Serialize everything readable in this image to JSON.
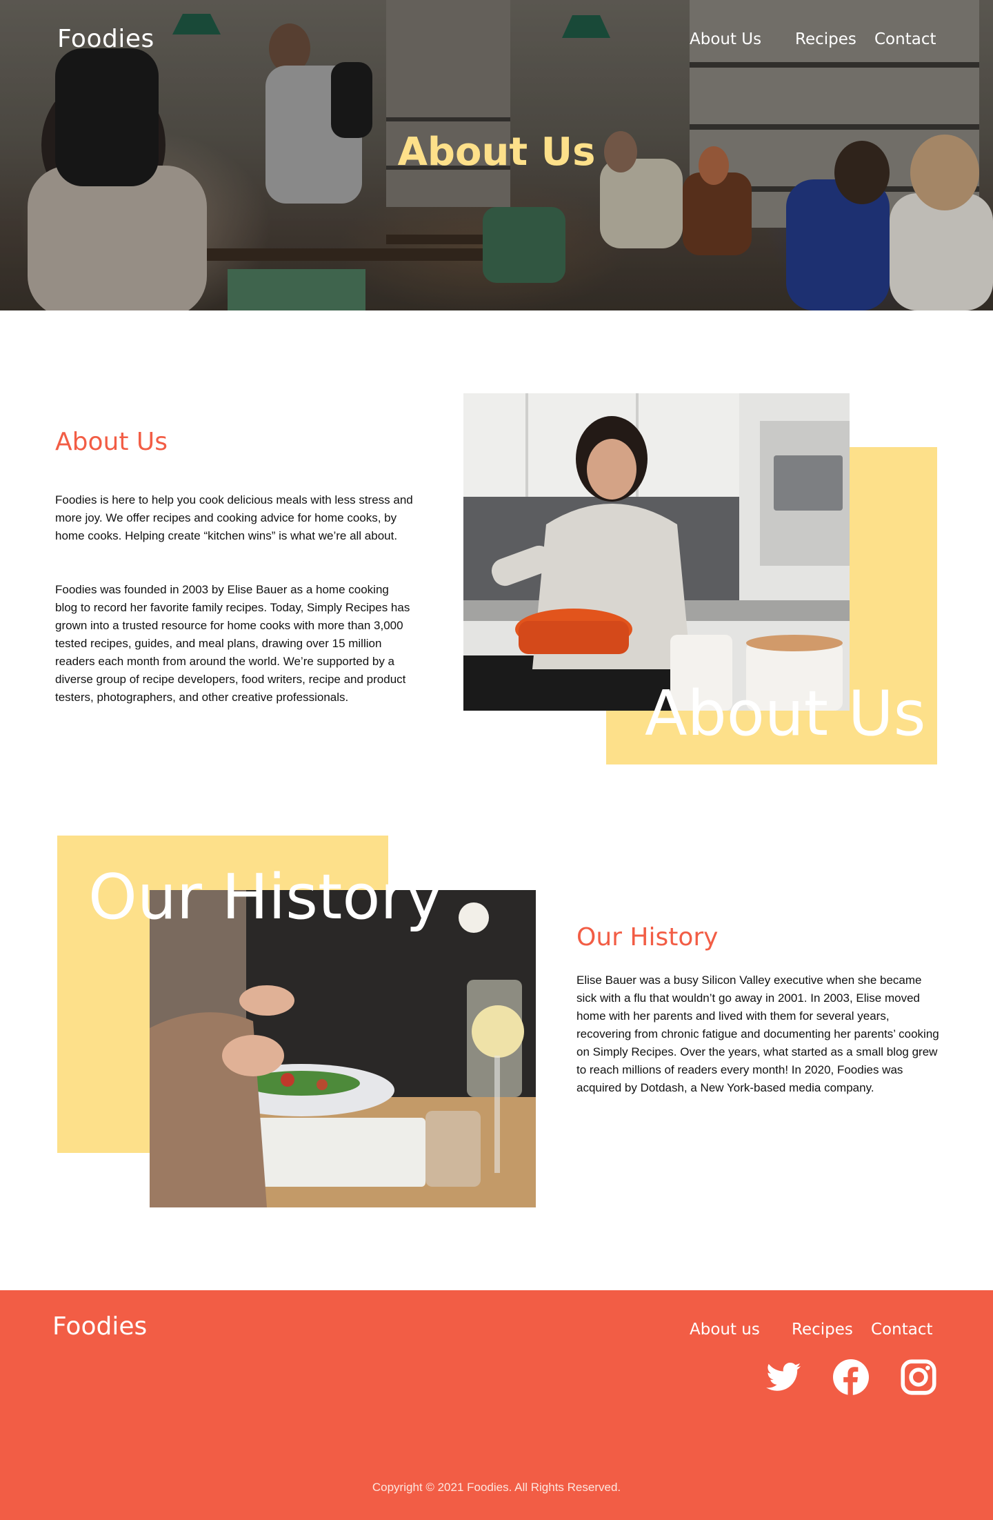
{
  "brand": {
    "logo_text": "Foodies",
    "primary_color": "#f25d45",
    "accent_color": "#fde08a"
  },
  "nav": {
    "items": [
      "About Us",
      "Recipes",
      "Contact"
    ]
  },
  "hero": {
    "title": "About Us",
    "image_desc": "busy cafe interior with people"
  },
  "about": {
    "heading": "About Us",
    "paragraphs": [
      "Foodies is here to help you cook delicious meals with less stress and more joy. We offer recipes and cooking advice for home cooks, by home cooks. Helping create “kitchen wins” is what we’re all about.",
      "Foodies was founded in 2003 by Elise Bauer as a home cooking blog to record her favorite family recipes. Today, Simply Recipes has grown into a trusted resource for home cooks with more than 3,000 tested recipes, guides, and meal plans, drawing over 15 million readers each month from around the world. We’re supported by a diverse group of recipe developers, food writers, recipe and product testers, photographers, and other creative professionals."
    ],
    "overlay_text": "About Us"
  },
  "history": {
    "heading": "Our History",
    "paragraph": "Elise Bauer was a busy Silicon Valley executive when she became sick with a flu that wouldn’t go away in 2001. In 2003, Elise moved home with her parents and lived with them for several years, recovering from chronic fatigue and documenting her parents’ cooking on Simply Recipes. Over the years, what started as a small blog grew to reach millions of readers every month! In 2020, Foodies was acquired by Dotdash, a New York-based media company.",
    "overlay_text": "Our History"
  },
  "footer": {
    "logo_text": "Foodies",
    "nav": [
      "About us",
      "Recipes",
      "Contact"
    ],
    "social": [
      "twitter-icon",
      "facebook-icon",
      "instagram-icon"
    ],
    "copyright": "Copyright © 2021 Foodies. All Rights Reserved."
  }
}
